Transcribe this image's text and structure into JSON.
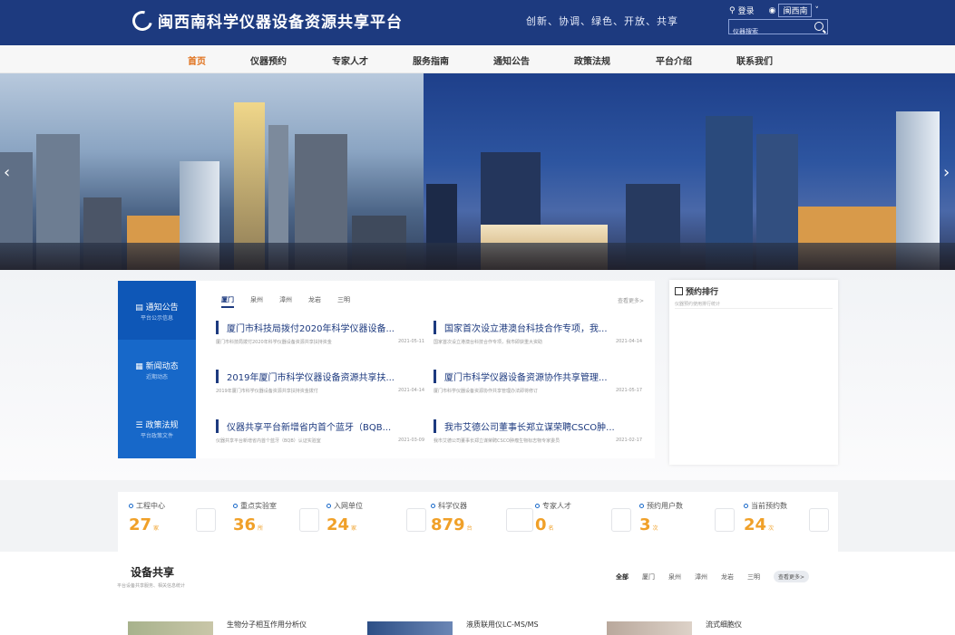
{
  "header": {
    "site_title": "闽西南科学仪器设备资源共享平台",
    "slogan": "创新、协调、绿色、开放、共享",
    "login_label": "登录",
    "region_label": "闽西南",
    "search_placeholder": "仪器搜索",
    "colors": {
      "header_bg": "#1d3a7f",
      "accent": "#e0711c"
    }
  },
  "nav": {
    "items": [
      {
        "label": "首页",
        "active": true
      },
      {
        "label": "仪器预约"
      },
      {
        "label": "专家人才"
      },
      {
        "label": "服务指南"
      },
      {
        "label": "通知公告"
      },
      {
        "label": "政策法规"
      },
      {
        "label": "平台介绍"
      },
      {
        "label": "联系我们"
      }
    ]
  },
  "banner": {
    "prev_icon": "chevron-left-icon",
    "next_icon": "chevron-right-icon"
  },
  "side_tabs": [
    {
      "label": "通知公告",
      "sub": "平台公示信息",
      "icon": "bulletin-icon",
      "active": true
    },
    {
      "label": "新闻动态",
      "sub": "近期动态",
      "icon": "news-icon"
    },
    {
      "label": "政策法规",
      "sub": "平台政策文件",
      "icon": "policy-icon"
    }
  ],
  "news": {
    "city_tabs": [
      "厦门",
      "泉州",
      "漳州",
      "龙岩",
      "三明"
    ],
    "more_label": "查看更多>",
    "items": [
      {
        "title": "厦门市科技局拨付2020年科学仪器设备...",
        "summary": "厦门市科技局拨付2020年科学仪器设备资源共享扶持资金",
        "date": "2021-05-11"
      },
      {
        "title": "国家首次设立港澳台科技合作专项，我...",
        "summary": "国家首次设立港澳台科技合作专项，我市即获重大资助",
        "date": "2021-04-14"
      },
      {
        "title": "2019年厦门市科学仪器设备资源共享扶...",
        "summary": "2019年厦门市科学仪器设备资源共享扶持资金拨付",
        "date": "2021-04-14"
      },
      {
        "title": "厦门市科学仪器设备资源协作共享管理...",
        "summary": "厦门市科学仪器设备资源协作共享管理办法即将修订",
        "date": "2021-05-17"
      },
      {
        "title": "仪器共享平台新增省内首个蓝牙（BQB...",
        "summary": "仪器共享平台新增省内首个蓝牙（BQB）认证实验室",
        "date": "2021-03-09"
      },
      {
        "title": "我市艾德公司董事长郑立谋荣聘CSCO肿...",
        "summary": "我市艾德公司董事长郑立谋荣聘CSCO肿瘤生物标志物专家委员",
        "date": "2021-02-17"
      }
    ]
  },
  "ranking": {
    "title": "预约排行",
    "subtitle": "仪器预约使用排行统计"
  },
  "stats": [
    {
      "label": "工程中心",
      "value": "27",
      "unit": "家"
    },
    {
      "label": "重点实验室",
      "value": "36",
      "unit": "所"
    },
    {
      "label": "入网单位",
      "value": "24",
      "unit": "家"
    },
    {
      "label": "科学仪器",
      "value": "879",
      "unit": "台"
    },
    {
      "label": "专家人才",
      "value": "0",
      "unit": "名"
    },
    {
      "label": "预约用户数",
      "value": "3",
      "unit": "次"
    },
    {
      "label": "当前预约数",
      "value": "24",
      "unit": "次"
    }
  ],
  "device_share": {
    "title": "设备共享",
    "subtitle": "平台设备共享服务、相关信息统计",
    "filters": [
      "全部",
      "厦门",
      "泉州",
      "漳州",
      "龙岩",
      "三明"
    ],
    "more_label": "查看更多>",
    "cards": [
      {
        "name": "生物分子相互作用分析仪"
      },
      {
        "name": "液质联用仪LC-MS/MS"
      },
      {
        "name": "流式细胞仪"
      }
    ]
  }
}
